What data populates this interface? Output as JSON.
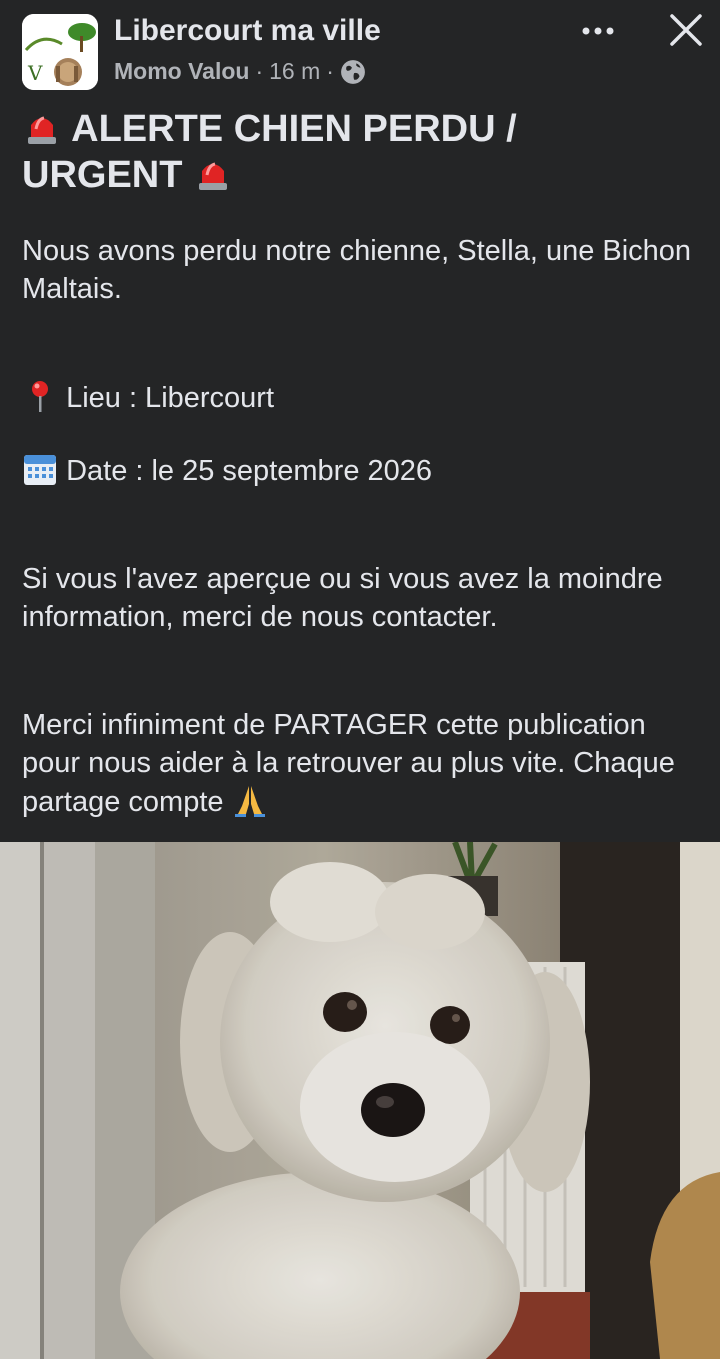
{
  "header": {
    "page_name": "Libercourt ma ville",
    "author": "Momo Valou",
    "separator": "·",
    "time": "16 m",
    "privacy_icon": "globe-icon",
    "more_icon": "more-horizontal-icon",
    "close_icon": "close-icon"
  },
  "post": {
    "title_line1": "ALERTE CHIEN PERDU /",
    "title_line2": "URGENT",
    "intro": "Nous avons perdu notre chienne, Stella, une Bichon Maltais.",
    "lieu": "Lieu : Libercourt",
    "date": "Date : le 25 septembre 2026",
    "contact": "Si vous l'avez aperçue ou si vous avez la moindre information, merci de nous contacter.",
    "share": "Merci infiniment de PARTAGER cette publication pour nous aider à la retrouver au plus vite. Chaque partage compte"
  },
  "photo": {
    "subject": "white-maltese-dog-photo"
  },
  "colors": {
    "background": "#242526",
    "text_primary": "#e4e6eb",
    "text_secondary": "#b0b3b8"
  }
}
